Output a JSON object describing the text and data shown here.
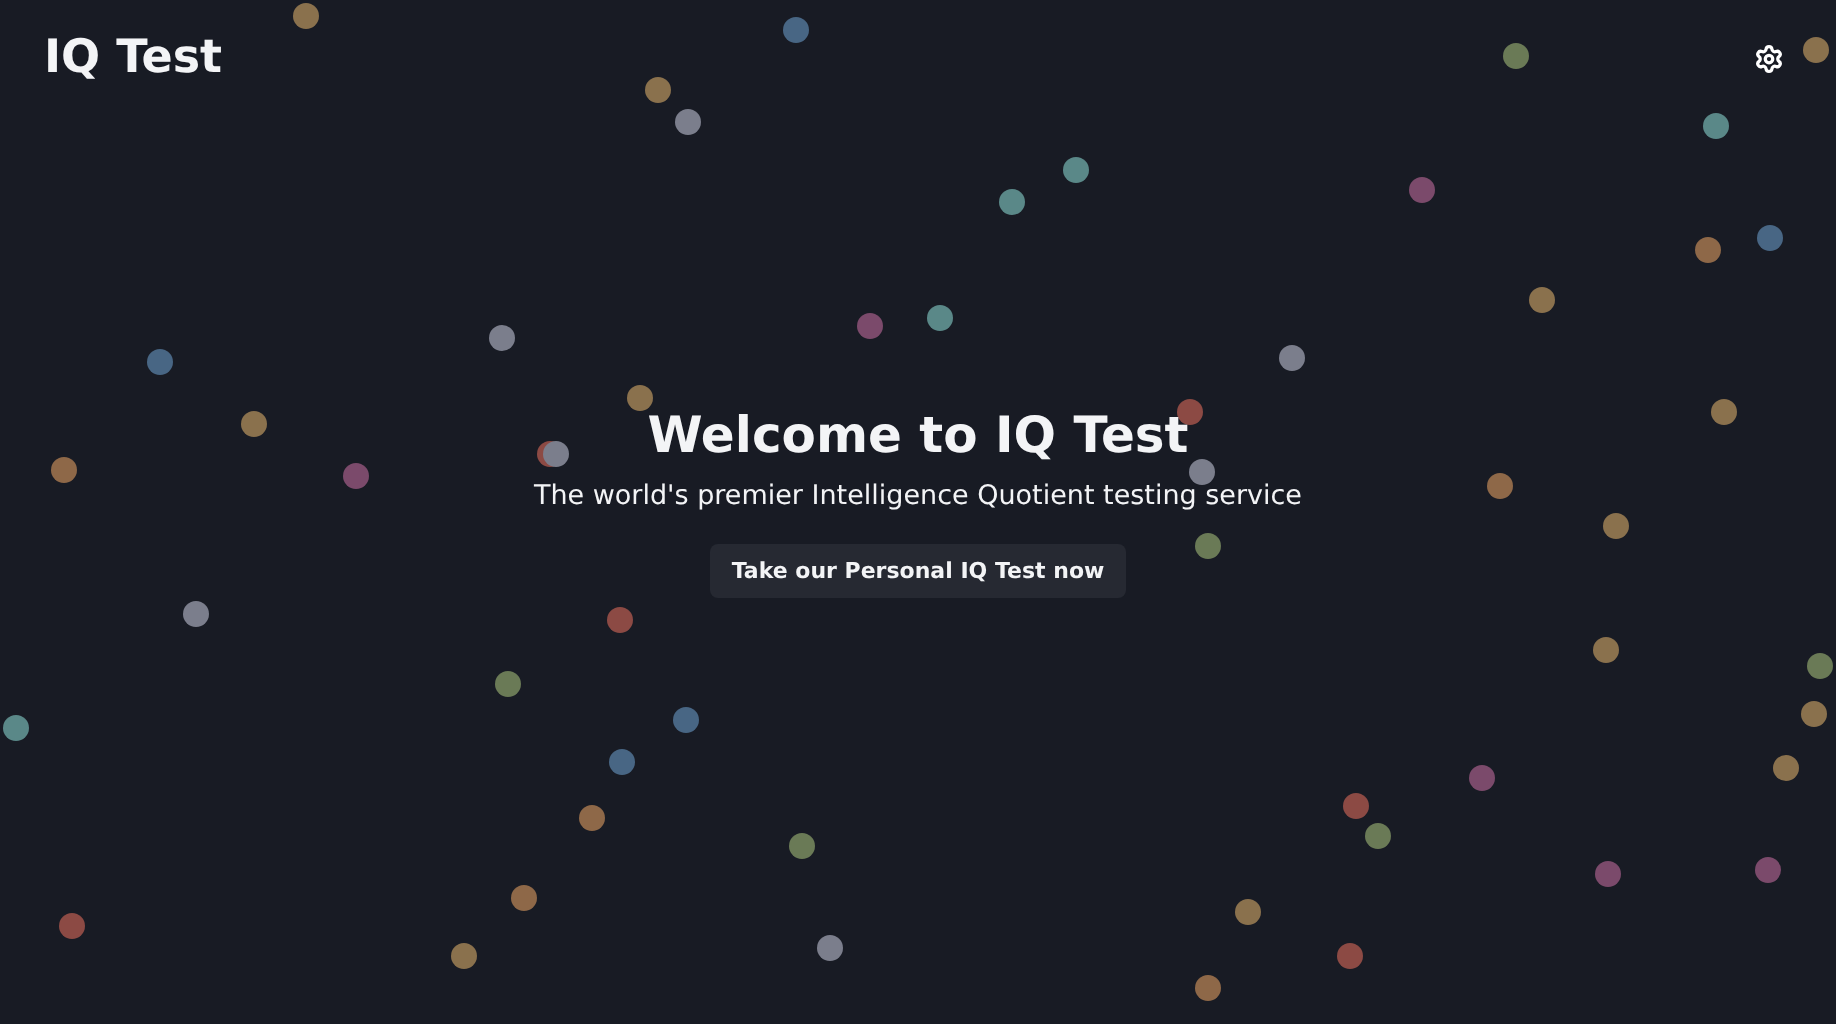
{
  "header": {
    "logo": "IQ Test"
  },
  "hero": {
    "title": "Welcome to IQ Test",
    "subtitle": "The world's premier Intelligence Quotient testing service",
    "button": "Take our Personal IQ Test now"
  }
}
